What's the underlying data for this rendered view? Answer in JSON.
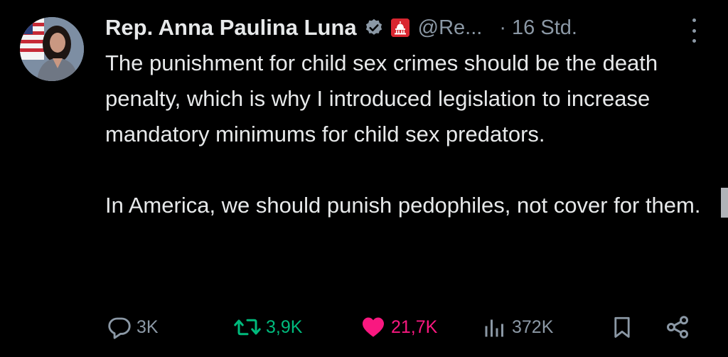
{
  "tweet": {
    "author": {
      "name": "Rep. Anna Paulina Luna",
      "handle": "@Re...",
      "verified_color": "#8b98a5",
      "affiliation_color": "#d92630",
      "avatar_icon": "profile-photo",
      "affiliation_icon": "capitol-dome-icon"
    },
    "separator": "·",
    "time": "16 Std.",
    "body": {
      "paragraph1": "The punishment for child sex crimes should be the death penalty, which is why I introduced legislation to increase mandatory minimums for child sex predators.",
      "paragraph2": "In America, we should punish pedophiles, not cover for them."
    },
    "actions": {
      "replies": "3K",
      "retweets": "3,9K",
      "likes": "21,7K",
      "views": "372K"
    },
    "colors": {
      "retweet_active": "#00ba7c",
      "like_active": "#f91880",
      "muted": "#8b98a5"
    }
  }
}
